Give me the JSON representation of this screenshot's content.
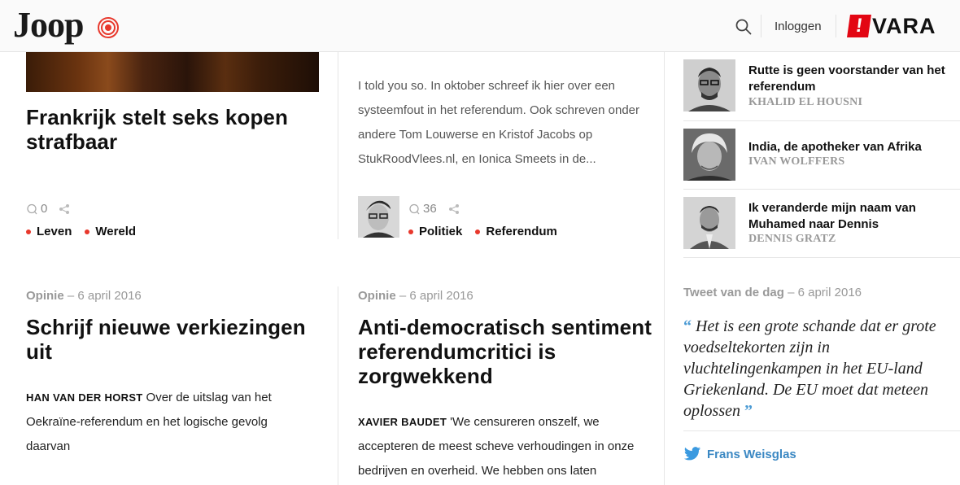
{
  "header": {
    "logo_text": "Joop",
    "login_label": "Inloggen",
    "vara_bang": "!",
    "vara_text": "VARA",
    "icons": {
      "search": "search-icon",
      "logo_mark": "target-icon"
    }
  },
  "colors": {
    "accent_red": "#e8382c",
    "twitter_blue": "#3b88c3",
    "vara_red": "#e30613"
  },
  "col1_top": {
    "headline": "Frankrijk stelt seks kopen strafbaar",
    "comment_count": "0",
    "tags": [
      "Leven",
      "Wereld"
    ]
  },
  "col2_top": {
    "teaser": "I told you so. In oktober schreef ik hier over een systeemfout in het referendum. Ook schreven onder andere Tom Louwerse en Kristof Jacobs op StukRoodVlees.nl, en Ionica Smeets in de...",
    "comment_count": "36",
    "tags": [
      "Politiek",
      "Referendum"
    ]
  },
  "col1_bottom": {
    "category": "Opinie",
    "sep": "–",
    "date": "6 april 2016",
    "headline": "Schrijf nieuwe verkiezingen uit",
    "author": "HAN VAN DER HORST",
    "intro": "Over de uitslag van het Oekraïne-referendum en het logische gevolg daarvan"
  },
  "col2_bottom": {
    "category": "Opinie",
    "sep": "–",
    "date": "6 april 2016",
    "headline": "Anti-democratisch sentiment referendumcritici is zorgwekkend",
    "author": "XAVIER BAUDET",
    "intro": "'We censureren onszelf, we accepteren de meest scheve verhoudingen in onze bedrijven en overheid. We hebben ons laten"
  },
  "sidebar": {
    "items": [
      {
        "title": "Rutte is geen voorstander van het referendum",
        "author": "KHALID EL HOUSNI"
      },
      {
        "title": "India, de apotheker van Afrika",
        "author": "IVAN WOLFFERS"
      },
      {
        "title": "Ik veranderde mijn naam van Muhamed naar Dennis",
        "author": "DENNIS GRATZ"
      }
    ],
    "tweet": {
      "label": "Tweet van de dag",
      "sep": "–",
      "date": "6 april 2016",
      "open_quote": "“",
      "text": "Het is een grote schande dat er grote voedseltekorten zijn in vluchtelingenkampen in het EU-land Griekenland. De EU moet dat meteen oplossen",
      "close_quote": "”",
      "author": "Frans Weisglas"
    }
  }
}
